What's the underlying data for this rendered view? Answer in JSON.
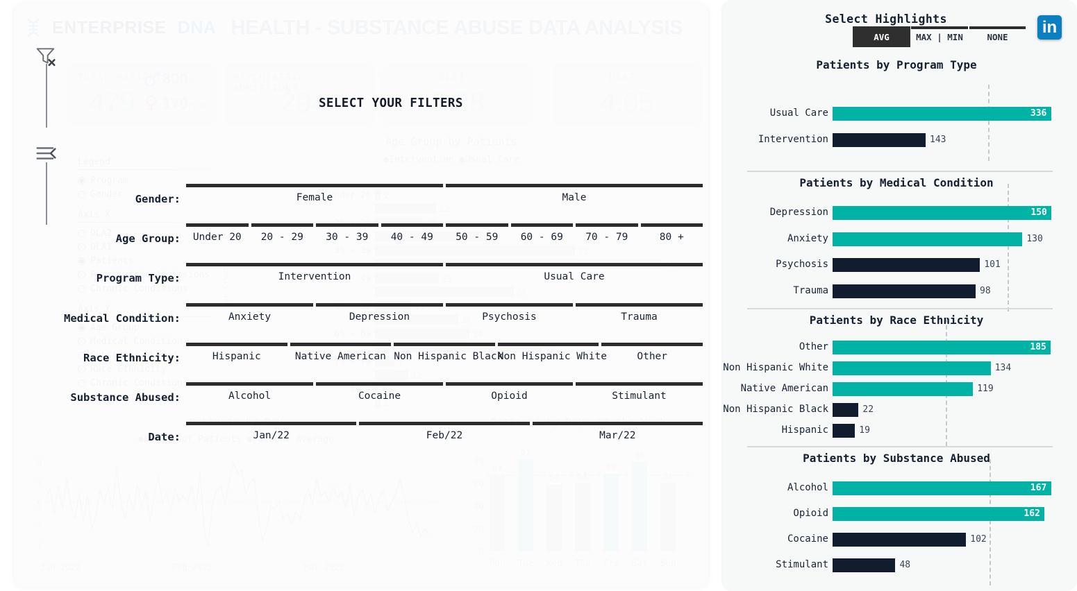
{
  "header": {
    "brand_primary": "ENTERPRISE",
    "brand_secondary": "DNA",
    "title": "HEALTH - SUBSTANCE ABUSE DATA ANALYSIS",
    "dna_icon": "dna-helix-icon"
  },
  "rail": {
    "clear_filter_icon": "clear-filter-icon",
    "collapse_menu_icon": "collapse-menu-icon"
  },
  "kpis": [
    {
      "label": "TOTAL PATIENTS",
      "value": "479",
      "male_symbol": "male-icon",
      "male_value": "300",
      "male_pct": "(63%)",
      "female_symbol": "female-icon",
      "female_value": "179",
      "female_pct": "(37%)"
    },
    {
      "label": "PSYCHIATRIC ADMISSIONS",
      "value": "294"
    },
    {
      "label": "DLA1",
      "value": "3.88"
    },
    {
      "label": "DLA2",
      "value": "4.05"
    }
  ],
  "controls": {
    "legend_head": "Legend",
    "legend_items": [
      {
        "label": "Program",
        "selected": true
      },
      {
        "label": "Gender",
        "selected": false
      }
    ],
    "axis_x_head": "Axis X",
    "axis_x_items": [
      {
        "label": "DLA2",
        "selected": false
      },
      {
        "label": "DLA1",
        "selected": false
      },
      {
        "label": "Patients",
        "selected": true
      },
      {
        "label": "Psychiatric Admissions",
        "selected": false
      },
      {
        "label": "Chronic Conditions",
        "selected": false
      }
    ],
    "axis_y_head": "Axis Y",
    "axis_y_items": [
      {
        "label": "Age Group",
        "selected": true
      },
      {
        "label": "Medical Condition",
        "selected": false
      },
      {
        "label": "Substance Abused",
        "selected": false
      },
      {
        "label": "Race Ethnicity",
        "selected": false
      },
      {
        "label": "Chronic Conditions",
        "selected": false
      }
    ]
  },
  "overlay": {
    "title": "SELECT YOUR FILTERS"
  },
  "filters": [
    {
      "label": "Gender:",
      "options": [
        "Female",
        "Male"
      ]
    },
    {
      "label": "Age Group:",
      "options": [
        "Under 20",
        "20 - 29",
        "30 - 39",
        "40 - 49",
        "50 - 59",
        "60 - 69",
        "70 - 79",
        "80 +"
      ]
    },
    {
      "label": "Program Type:",
      "options": [
        "Intervention",
        "Usual Care"
      ]
    },
    {
      "label": "Medical Condition:",
      "options": [
        "Anxiety",
        "Depression",
        "Psychosis",
        "Trauma"
      ]
    },
    {
      "label": "Race Ethnicity:",
      "options": [
        "Hispanic",
        "Native American",
        "Non Hispanic Black",
        "Non Hispanic White",
        "Other"
      ]
    },
    {
      "label": "Substance Abused:",
      "options": [
        "Alcohol",
        "Cocaine",
        "Opioid",
        "Stimulant"
      ]
    },
    {
      "label": "Date:",
      "options": [
        "Jan/22",
        "Feb/22",
        "Mar/22"
      ]
    }
  ],
  "highlights": {
    "title": "Select Highlights",
    "options": [
      {
        "label": "AVG",
        "active": true
      },
      {
        "label": "MAX | MIN",
        "active": false
      },
      {
        "label": "NONE",
        "active": false
      }
    ],
    "linkedin_icon": "linkedin-icon",
    "colors": {
      "highlight": "#00b3a4",
      "base": "#111d2e",
      "panel": "#f7f8f8"
    }
  },
  "chart_data": [
    {
      "type": "bar",
      "orientation": "horizontal",
      "title": "Patients by Program Type",
      "categories": [
        "Usual Care",
        "Intervention"
      ],
      "values": [
        336,
        143
      ],
      "highlighted": [
        true,
        false
      ],
      "average_line": 239.5,
      "xlabel": "",
      "ylabel": "",
      "xlim": [
        0,
        350
      ],
      "grid": false
    },
    {
      "type": "bar",
      "orientation": "horizontal",
      "title": "Patients by Medical Condition",
      "categories": [
        "Depression",
        "Anxiety",
        "Psychosis",
        "Trauma"
      ],
      "values": [
        150,
        130,
        101,
        98
      ],
      "highlighted": [
        true,
        true,
        false,
        false
      ],
      "average_line": 119.75,
      "xlabel": "",
      "ylabel": "",
      "xlim": [
        0,
        156
      ],
      "grid": false
    },
    {
      "type": "bar",
      "orientation": "horizontal",
      "title": "Patients by Race Ethnicity",
      "categories": [
        "Other",
        "Non Hispanic White",
        "Native American",
        "Non Hispanic Black",
        "Hispanic"
      ],
      "values": [
        185,
        134,
        119,
        22,
        19
      ],
      "highlighted": [
        true,
        true,
        true,
        false,
        false
      ],
      "average_line": 95.8,
      "xlabel": "",
      "ylabel": "",
      "xlim": [
        0,
        193
      ],
      "grid": false
    },
    {
      "type": "bar",
      "orientation": "horizontal",
      "title": "Patients by Substance Abused",
      "categories": [
        "Alcohol",
        "Opioid",
        "Cocaine",
        "Stimulant"
      ],
      "values": [
        167,
        162,
        102,
        48
      ],
      "highlighted": [
        true,
        true,
        false,
        false
      ],
      "average_line": 119.75,
      "xlabel": "",
      "ylabel": "",
      "xlim": [
        0,
        174
      ],
      "grid": false
    },
    {
      "type": "bar",
      "orientation": "horizontal",
      "title": "Age Group by Patients",
      "legend": [
        "Intervention",
        "Usual Care"
      ],
      "categories": [
        "Under 20",
        "20 - 29",
        "30 - 39",
        "40 - 49",
        "50 - 59",
        "60 - 69",
        "70 - 79",
        "80 +"
      ],
      "series": [
        {
          "name": "Intervention",
          "values": [
            2,
            17,
            72,
            23,
            13,
            34,
            7,
            1
          ]
        },
        {
          "name": "Usual Care",
          "values": [
            22,
            39,
            103,
            50,
            30,
            60,
            12,
            2
          ]
        }
      ],
      "ylabel": "Age Group",
      "xlabel": "",
      "grid": false
    },
    {
      "type": "line",
      "title": "Patients by Day",
      "legend": [
        "Number of Patients",
        "Patient Average"
      ],
      "x": [
        "Jan 2022",
        "Feb 2022",
        "Mar 2022"
      ],
      "yticks": [
        1,
        3,
        5,
        7,
        9
      ],
      "ylim": [
        0,
        10
      ],
      "grid": false
    },
    {
      "type": "bar",
      "orientation": "vertical",
      "title": "Patients by Days of the Week",
      "categories": [
        "Mon",
        "Tue",
        "Wed",
        "Thu",
        "Fri",
        "Sat",
        "Sun"
      ],
      "values": [
        67,
        82,
        59,
        61,
        69,
        80,
        61
      ],
      "highlighted": [
        false,
        true,
        false,
        false,
        true,
        true,
        false
      ],
      "yticks": [
        0,
        20,
        40,
        60,
        80
      ],
      "ylim": [
        0,
        88
      ],
      "average_line": 68.4,
      "grid": false
    }
  ]
}
